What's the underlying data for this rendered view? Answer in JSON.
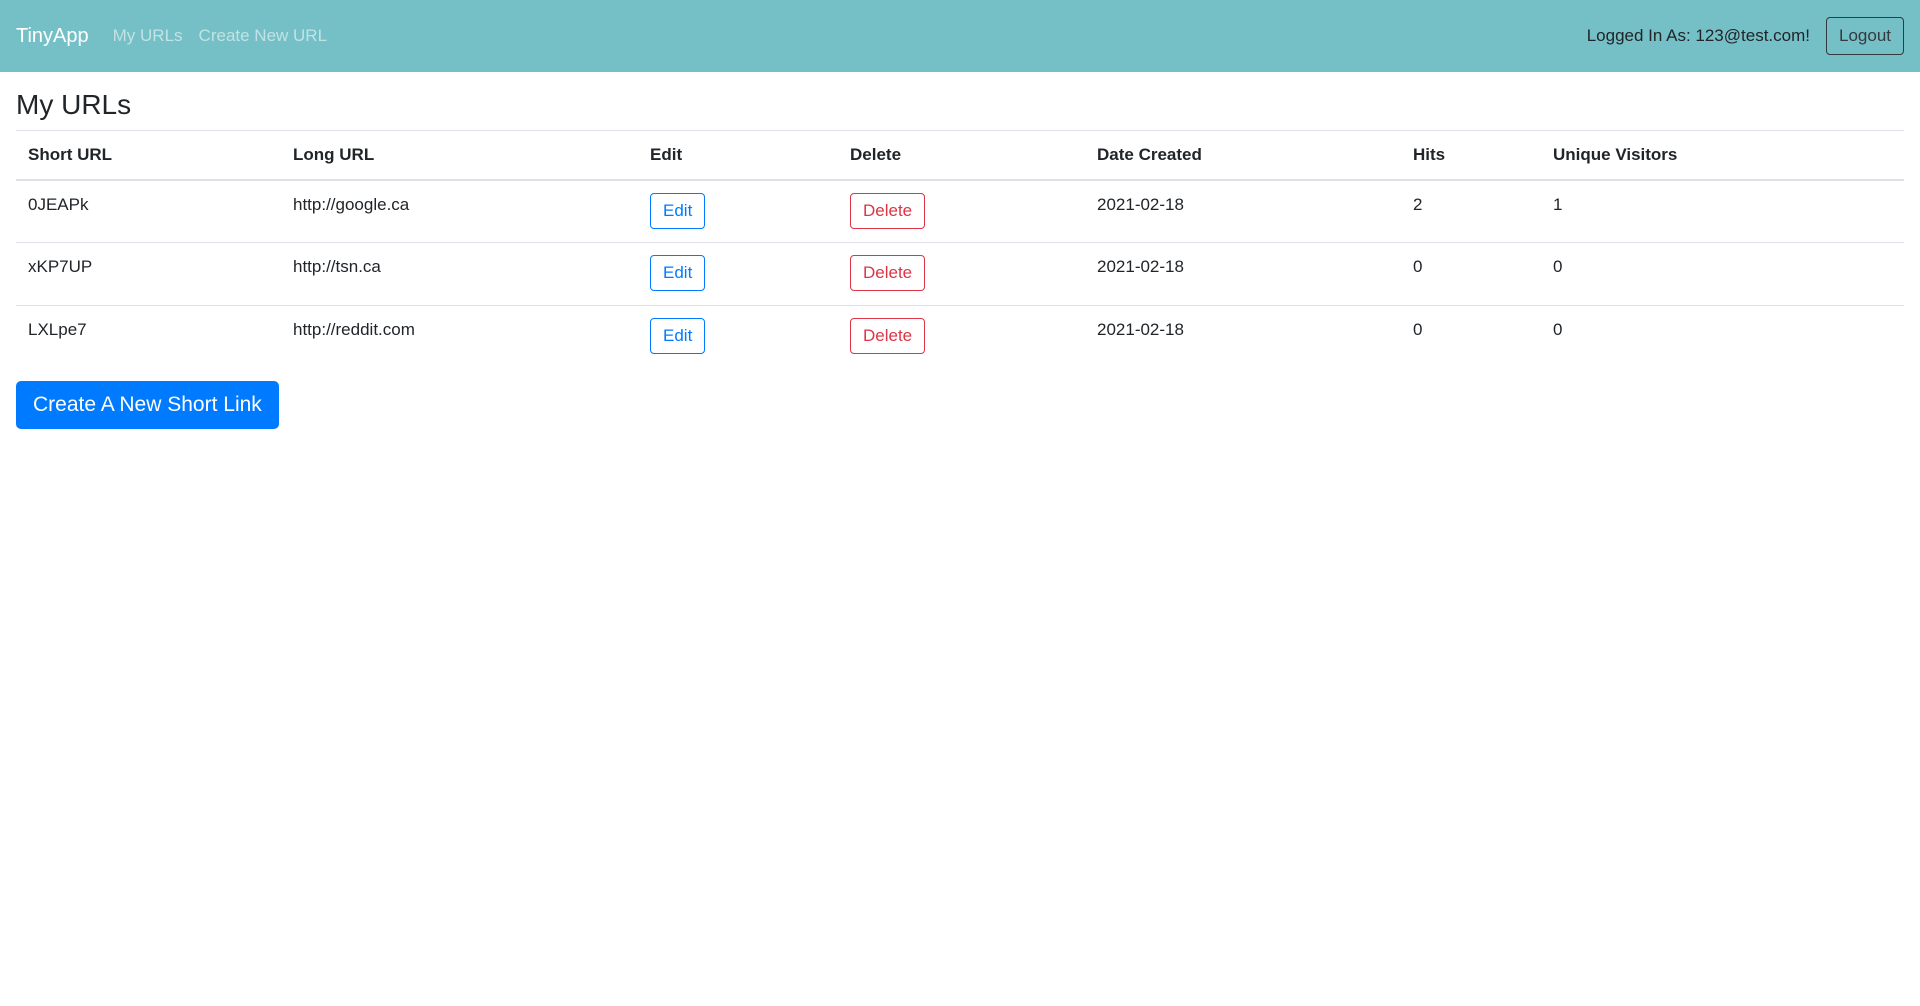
{
  "navbar": {
    "brand": "TinyApp",
    "links": [
      {
        "label": "My URLs"
      },
      {
        "label": "Create New URL"
      }
    ],
    "logged_in_text": "Logged In As: 123@test.com!",
    "logout_label": "Logout",
    "background_color": "#75c0c6"
  },
  "main": {
    "title": "My URLs",
    "table": {
      "headers": [
        "Short URL",
        "Long URL",
        "Edit",
        "Delete",
        "Date Created",
        "Hits",
        "Unique Visitors"
      ],
      "rows": [
        {
          "short_url": "0JEAPk",
          "long_url": "http://google.ca",
          "edit_label": "Edit",
          "delete_label": "Delete",
          "date_created": "2021-02-18",
          "hits": "2",
          "unique_visitors": "1"
        },
        {
          "short_url": "xKP7UP",
          "long_url": "http://tsn.ca",
          "edit_label": "Edit",
          "delete_label": "Delete",
          "date_created": "2021-02-18",
          "hits": "0",
          "unique_visitors": "0"
        },
        {
          "short_url": "LXLpe7",
          "long_url": "http://reddit.com",
          "edit_label": "Edit",
          "delete_label": "Delete",
          "date_created": "2021-02-18",
          "hits": "0",
          "unique_visitors": "0"
        }
      ]
    },
    "create_button_label": "Create A New Short Link"
  },
  "colors": {
    "primary": "#007bff",
    "danger": "#dc3545"
  }
}
